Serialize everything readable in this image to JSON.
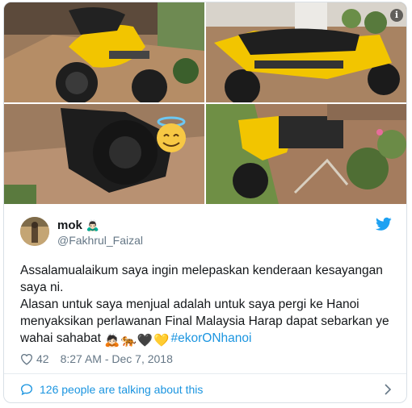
{
  "author": {
    "display_name": "mok",
    "name_emoji": "🙇🏻‍♂️",
    "handle": "@Fakhrul_Faizal"
  },
  "tweet": {
    "line1": "Assalamualaikum saya ingin melepaskan kenderaan kesayangan saya ni.",
    "line2": "Alasan untuk saya menjual adalah untuk saya pergi ke Hanoi menyaksikan perlawanan Final Malaysia Harap dapat sebarkan ye wahai sahabat",
    "emojis": [
      "🙇🏻",
      "🐅",
      "🖤",
      "💛"
    ],
    "hashtag": "#ekorONhanoi"
  },
  "meta": {
    "like_count": "42",
    "timestamp": "8:27 AM - Dec 7, 2018"
  },
  "footer": {
    "talking_text": "126 people are talking about this"
  },
  "colors": {
    "link": "#1b95e0",
    "secondary_text": "#657786",
    "border": "#d9e0e6",
    "motorcycle_yellow": "#f2c500"
  },
  "icons": [
    "info-icon",
    "twitter-bird-icon",
    "heart-icon",
    "talking-icon",
    "chevron-right-icon",
    "halo-smiley-sticker"
  ]
}
